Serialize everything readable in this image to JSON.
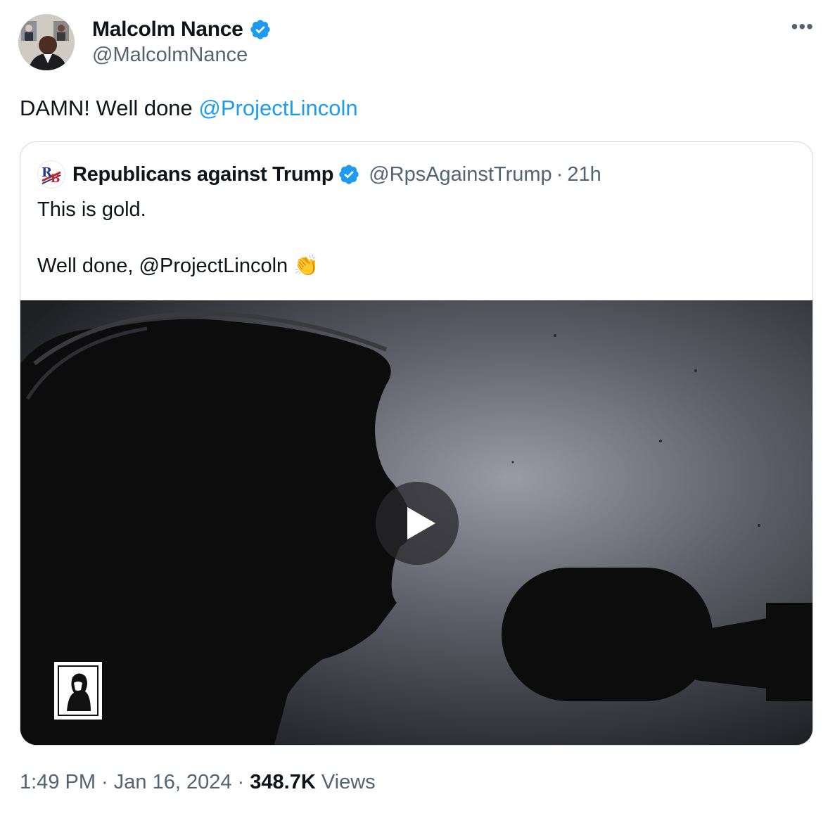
{
  "author": {
    "name": "Malcolm Nance",
    "handle": "@MalcolmNance",
    "verified": true
  },
  "tweet": {
    "text_prefix": "DAMN! Well done ",
    "mention": "@ProjectLincoln"
  },
  "quoted": {
    "name": "Republicans against Trump",
    "handle": "@RpsAgainstTrump",
    "separator": "·",
    "time": "21h",
    "line1": "This is gold.",
    "line2": "Well done, @ProjectLincoln 👏",
    "avatar_text": "RB",
    "media": {
      "type": "video",
      "play_icon": "play-icon"
    }
  },
  "meta": {
    "time": "1:49 PM",
    "sep1": " · ",
    "date": "Jan 16, 2024",
    "sep2": " · ",
    "views_count": "348.7K",
    "views_label": " Views"
  },
  "more_icon": "more-icon",
  "colors": {
    "accent": "#1d9bf0",
    "secondary": "#536471",
    "primary": "#0f1419",
    "border": "#cfd9de"
  }
}
